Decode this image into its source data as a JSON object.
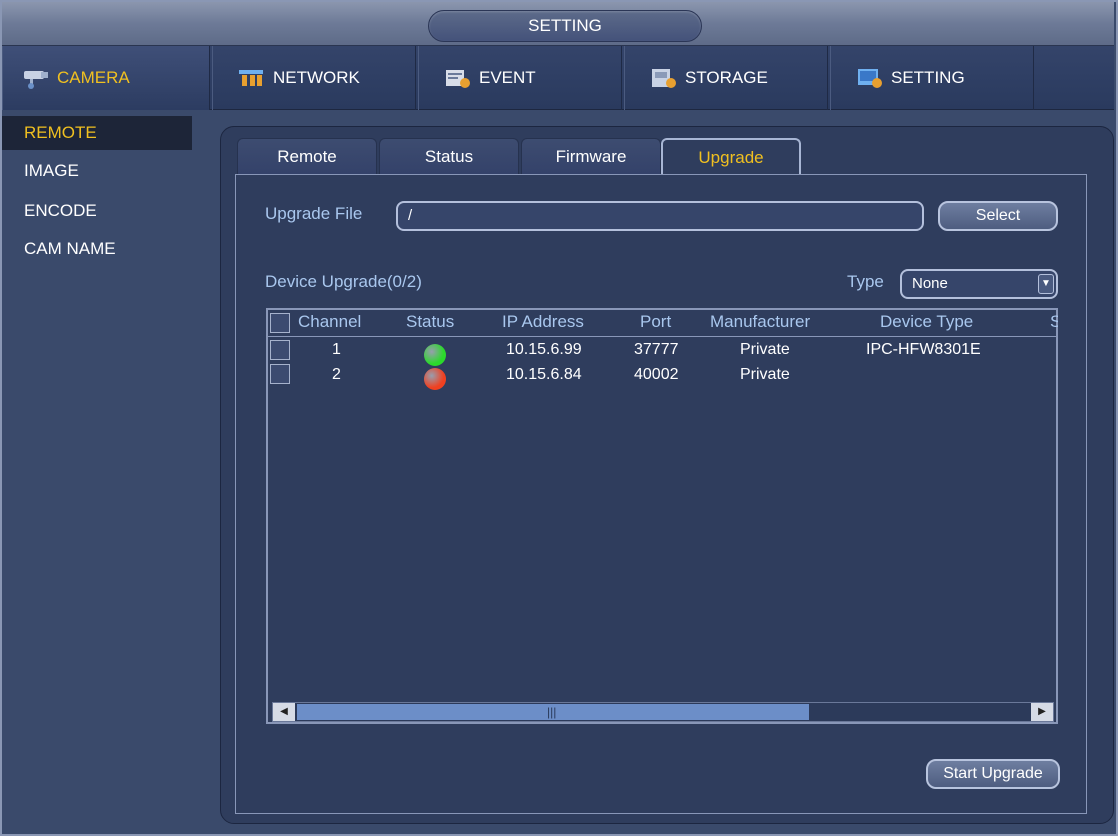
{
  "window": {
    "title": "SETTING"
  },
  "topnav": {
    "items": [
      {
        "label": "CAMERA",
        "icon": "camera-icon"
      },
      {
        "label": "NETWORK",
        "icon": "network-icon"
      },
      {
        "label": "EVENT",
        "icon": "event-icon"
      },
      {
        "label": "STORAGE",
        "icon": "storage-icon"
      },
      {
        "label": "SETTING",
        "icon": "setting-icon"
      }
    ]
  },
  "sidebar": {
    "items": [
      {
        "label": "REMOTE"
      },
      {
        "label": "IMAGE"
      },
      {
        "label": "ENCODE"
      },
      {
        "label": "CAM NAME"
      }
    ]
  },
  "tabs": [
    {
      "label": "Remote"
    },
    {
      "label": "Status"
    },
    {
      "label": "Firmware"
    },
    {
      "label": "Upgrade"
    }
  ],
  "upgrade": {
    "file_label": "Upgrade File",
    "file_value": "/",
    "select_label": "Select",
    "device_upgrade_label": "Device Upgrade(0/2)",
    "type_label": "Type",
    "type_value": "None",
    "start_label": "Start Upgrade"
  },
  "table": {
    "headers": [
      "Channel",
      "Status",
      "IP Address",
      "Port",
      "Manufacturer",
      "Device Type",
      "S"
    ],
    "rows": [
      {
        "channel": "1",
        "status_color": "#2bd92b",
        "ip": "10.15.6.99",
        "port": "37777",
        "manufacturer": "Private",
        "device_type": "IPC-HFW8301E"
      },
      {
        "channel": "2",
        "status_color": "#f04020",
        "ip": "10.15.6.84",
        "port": "40002",
        "manufacturer": "Private",
        "device_type": ""
      }
    ]
  },
  "colors": {
    "accent": "#f0c020",
    "label": "#a9c7ee",
    "status_online": "#2bd92b",
    "status_offline": "#f04020"
  }
}
